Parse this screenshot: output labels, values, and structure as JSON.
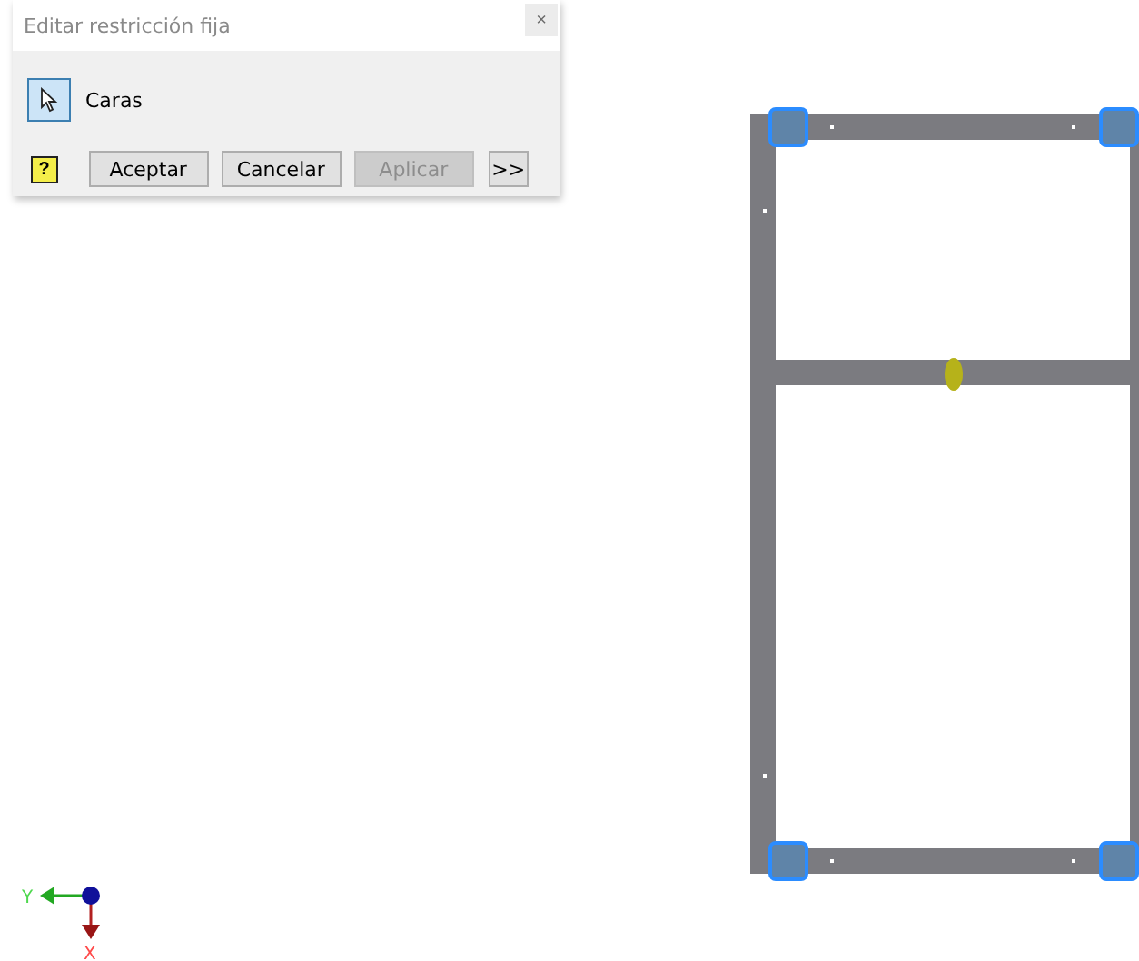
{
  "dialog": {
    "title": "Editar restricción fija",
    "close": "×",
    "selector": {
      "label": "Caras",
      "selected": true
    },
    "help": "?",
    "buttons": [
      {
        "label": "Aceptar",
        "disabled": false
      },
      {
        "label": "Cancelar",
        "disabled": false
      },
      {
        "label": "Aplicar",
        "disabled": true
      },
      {
        "label": ">>",
        "disabled": false
      }
    ]
  },
  "triad": {
    "y_axis": "Y",
    "x_axis": "X"
  }
}
